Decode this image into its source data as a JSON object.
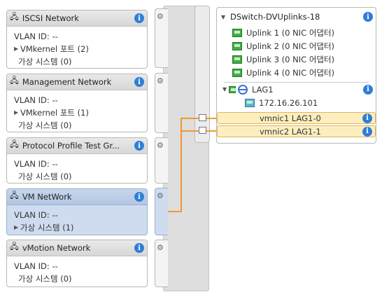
{
  "portgroups": [
    {
      "title": "ISCSI Network",
      "lines": [
        {
          "text": "VLAN ID: --",
          "expand": false
        },
        {
          "text": "VMkernel 포트 (2)",
          "expand": true
        },
        {
          "text": "가상 시스템 (0)",
          "expand": false
        }
      ]
    },
    {
      "title": "Management Network",
      "lines": [
        {
          "text": "VLAN ID: --",
          "expand": false
        },
        {
          "text": "VMkernel 포트 (1)",
          "expand": true
        },
        {
          "text": "가상 시스템 (0)",
          "expand": false
        }
      ]
    },
    {
      "title": "Protocol Profile Test Gr...",
      "lines": [
        {
          "text": "VLAN ID: --",
          "expand": false
        },
        {
          "text": "가상 시스템 (0)",
          "expand": false
        }
      ]
    },
    {
      "title": "VM NetWork",
      "selected": true,
      "lines": [
        {
          "text": "VLAN ID: --",
          "expand": false
        },
        {
          "text": "가상 시스템 (1)",
          "expand": true
        }
      ]
    },
    {
      "title": "vMotion Network",
      "lines": [
        {
          "text": "VLAN ID: --",
          "expand": false
        },
        {
          "text": "가상 시스템 (0)",
          "expand": false
        }
      ]
    }
  ],
  "switch": {
    "title": "DSwitch-DVUplinks-18",
    "uplinks": [
      "Uplink 1 (0 NIC 어댑터)",
      "Uplink 2 (0 NIC 어댑터)",
      "Uplink 3 (0 NIC 어댑터)",
      "Uplink 4 (0 NIC 어댑터)"
    ],
    "lag": {
      "name": "LAG1",
      "ip": "172.16.26.101",
      "nics": [
        "vmnic1 LAG1-0",
        "vmnic2 LAG1-1"
      ]
    }
  },
  "colors": {
    "highlight_line": "#f29a2e",
    "info": "#2f7ed8",
    "selected": "#cfdcef"
  }
}
